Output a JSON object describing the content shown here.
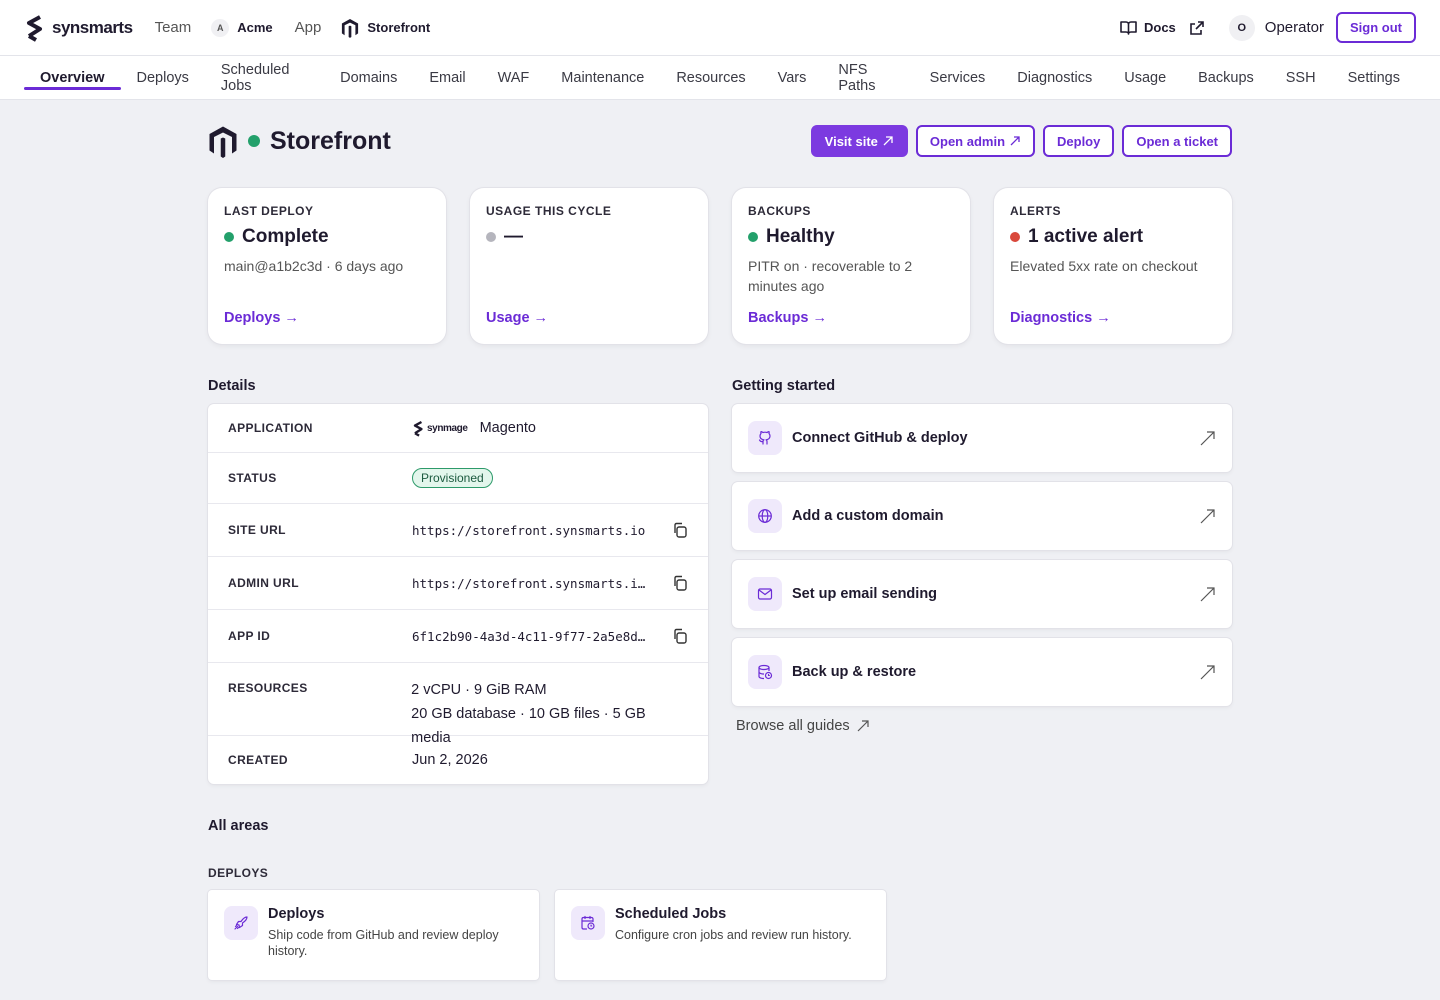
{
  "topbar": {
    "brand": "synsmarts",
    "team_label": "Team",
    "org_initial": "A",
    "org_name": "Acme",
    "app_label": "App",
    "app_name": "Storefront",
    "docs_label": "Docs",
    "user_initial": "O",
    "user_name": "Operator",
    "signout_label": "Sign out"
  },
  "tabs": [
    {
      "label": "Overview",
      "active": true
    },
    {
      "label": "Deploys"
    },
    {
      "label": "Scheduled Jobs"
    },
    {
      "label": "Domains"
    },
    {
      "label": "Email"
    },
    {
      "label": "WAF"
    },
    {
      "label": "Maintenance"
    },
    {
      "label": "Resources"
    },
    {
      "label": "Vars"
    },
    {
      "label": "NFS Paths"
    },
    {
      "label": "Services"
    },
    {
      "label": "Diagnostics"
    },
    {
      "label": "Usage"
    },
    {
      "label": "Backups"
    },
    {
      "label": "SSH"
    },
    {
      "label": "Settings"
    }
  ],
  "header": {
    "title": "Storefront",
    "status_color": "#23a06b",
    "actions": {
      "visit": "Visit site",
      "admin": "Open admin",
      "deploy": "Deploy",
      "ticket": "Open a ticket"
    }
  },
  "stats": [
    {
      "label": "LAST DEPLOY",
      "value": "Complete",
      "dot": "#23a06b",
      "sub": "main@a1b2c3d · 6 days ago",
      "link": "Deploys →"
    },
    {
      "label": "USAGE THIS CYCLE",
      "value": "—",
      "dot": "#b5b5bd",
      "sub": "",
      "link": "Usage →"
    },
    {
      "label": "BACKUPS",
      "value": "Healthy",
      "dot": "#23a06b",
      "sub": "PITR on · recoverable to 2 minutes ago",
      "link": "Backups →"
    },
    {
      "label": "ALERTS",
      "value": "1 active alert",
      "dot": "#d9483b",
      "sub": "Elevated 5xx rate on checkout",
      "link": "Diagnostics →"
    }
  ],
  "details": {
    "title": "Details",
    "application": {
      "key": "APPLICATION",
      "logo_text": "synmage",
      "value": "Magento"
    },
    "status": {
      "key": "STATUS",
      "value": "Provisioned"
    },
    "site_url": {
      "key": "SITE URL",
      "value": "https://storefront.synsmarts.io"
    },
    "admin_url": {
      "key": "ADMIN URL",
      "value": "https://storefront.synsmarts.i…"
    },
    "app_id": {
      "key": "APP ID",
      "value": "6f1c2b90-4a3d-4c11-9f77-2a5e8d…"
    },
    "resources": {
      "key": "RESOURCES",
      "line1": "2 vCPU · 9 GiB RAM",
      "line2": "20 GB database · 10 GB files · 5 GB media"
    },
    "created": {
      "key": "CREATED",
      "value": "Jun 2, 2026"
    }
  },
  "getting_started": {
    "title": "Getting started",
    "guides": [
      {
        "title": "Connect GitHub & deploy",
        "icon": "github-icon"
      },
      {
        "title": "Add a custom domain",
        "icon": "globe-icon"
      },
      {
        "title": "Set up email sending",
        "icon": "mail-icon"
      },
      {
        "title": "Back up & restore",
        "icon": "database-icon"
      }
    ],
    "browse": "Browse all guides"
  },
  "all_areas": {
    "title": "All areas",
    "group": "DEPLOYS",
    "cards": [
      {
        "title": "Deploys",
        "desc": "Ship code from GitHub and review deploy history.",
        "icon": "rocket-icon"
      },
      {
        "title": "Scheduled Jobs",
        "desc": "Configure cron jobs and review run history.",
        "icon": "calendar-clock-icon"
      }
    ]
  },
  "colors": {
    "accent": "#6b2bd6",
    "success": "#23a06b",
    "danger": "#d9483b"
  }
}
